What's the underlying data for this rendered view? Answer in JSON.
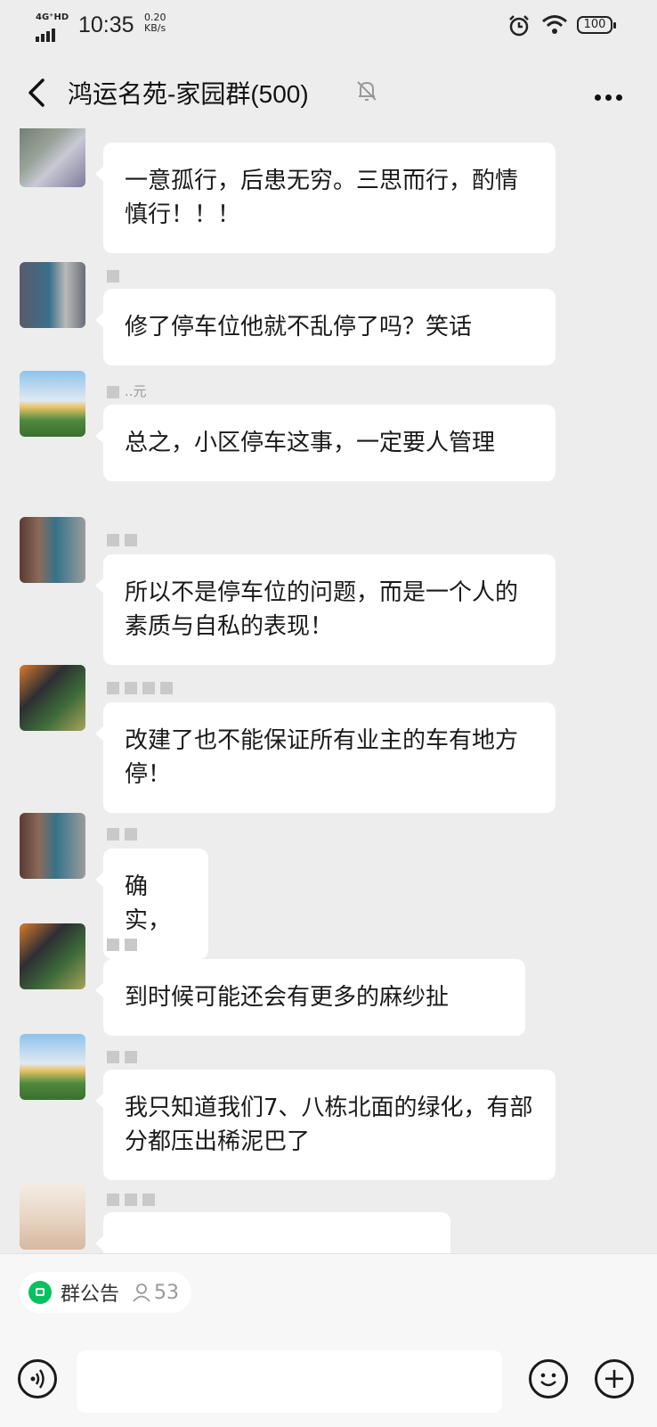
{
  "status": {
    "network": "4G⁺HD",
    "time": "10:35",
    "speed_value": "0.20",
    "speed_unit": "KB/s",
    "battery": "100"
  },
  "nav": {
    "title": "鸿运名苑-家园群(500)",
    "back_icon": "chevron-left-icon",
    "mute_icon": "bell-off-icon",
    "more_icon": "more-icon"
  },
  "messages": [
    {
      "sender": "",
      "text": "一意孤行，后患无穷。三思而行，酌情慎行！！！"
    },
    {
      "sender": "",
      "text": "修了停车位他就不乱停了吗？笑话"
    },
    {
      "sender": "..元",
      "text": "总之，小区停车这事，一定要人管理"
    },
    {
      "sender": "",
      "text": "所以不是停车位的问题，而是一个人的素质与自私的表现！"
    },
    {
      "sender": "",
      "text": "改建了也不能保证所有业主的车有地方停！"
    },
    {
      "sender": "",
      "text": "确实，"
    },
    {
      "sender": "",
      "text": "到时候可能还会有更多的麻纱扯"
    },
    {
      "sender": "",
      "text": "我只知道我们7、八栋北面的绿化，有部分都压出稀泥巴了"
    }
  ],
  "bottom": {
    "notice_label": "群公告",
    "member_count": "53"
  },
  "colors": {
    "background": "#ededed",
    "bubble": "#ffffff",
    "accent": "#07c160"
  }
}
